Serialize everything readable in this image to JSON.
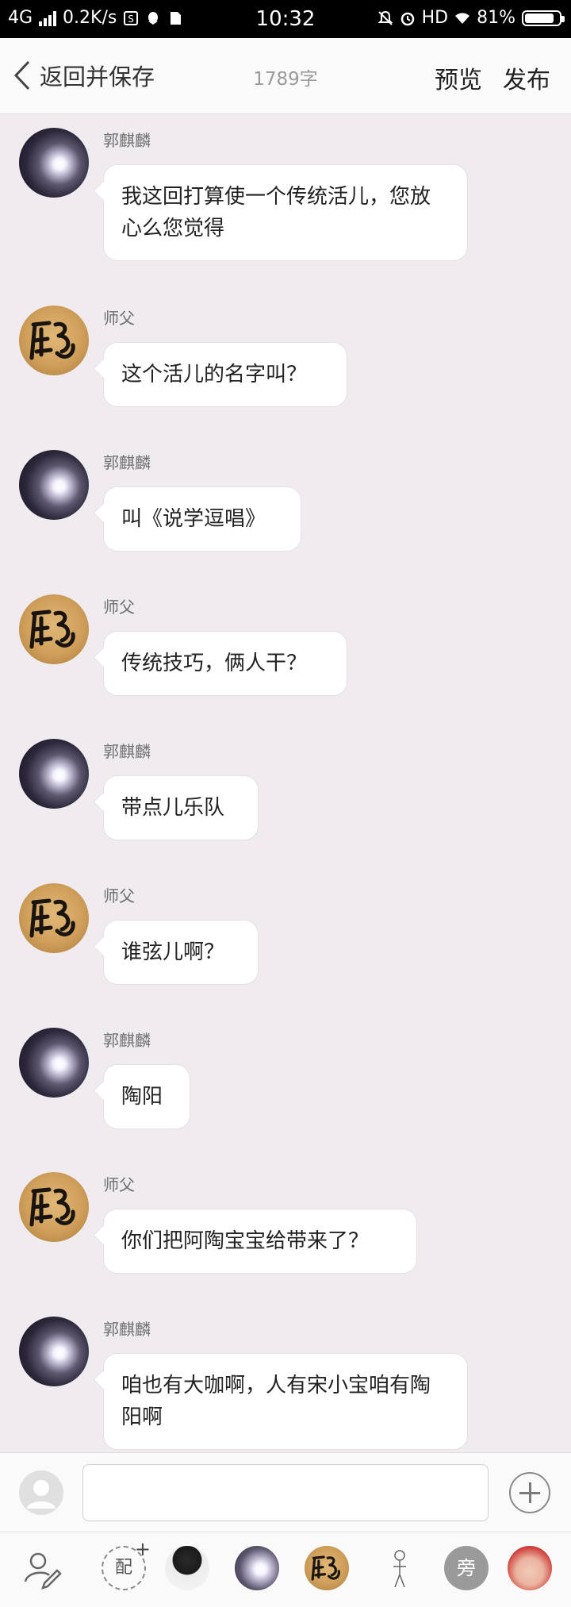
{
  "status_bar": {
    "network": "4G",
    "speed": "0.2K/s",
    "time": "10:32",
    "hd": "HD",
    "battery": "81%"
  },
  "header": {
    "back_label": "返回并保存",
    "word_count": "1789字",
    "preview_label": "预览",
    "publish_label": "发布"
  },
  "messages": [
    {
      "speaker": "郭麒麟",
      "text": "我这回打算使一个传统活儿，您放心么您觉得"
    },
    {
      "speaker": "师父",
      "text": "这个活儿的名字叫？"
    },
    {
      "speaker": "郭麒麟",
      "text": "叫《说学逗唱》"
    },
    {
      "speaker": "师父",
      "text": "传统技巧，俩人干？"
    },
    {
      "speaker": "郭麒麟",
      "text": "带点儿乐队"
    },
    {
      "speaker": "师父",
      "text": "谁弦儿啊？"
    },
    {
      "speaker": "郭麒麟",
      "text": "陶阳"
    },
    {
      "speaker": "师父",
      "text": "你们把阿陶宝宝给带来了？"
    },
    {
      "speaker": "郭麒麟",
      "text": "咱也有大咖啊，人有宋小宝咱有陶阳啊"
    }
  ],
  "input": {
    "value": "",
    "placeholder": ""
  },
  "role_bar": {
    "add_role_label": "配",
    "side_role_label": "旁"
  },
  "colors": {
    "background": "#efebef",
    "bubble": "#ffffff",
    "status_bar": "#000000"
  }
}
